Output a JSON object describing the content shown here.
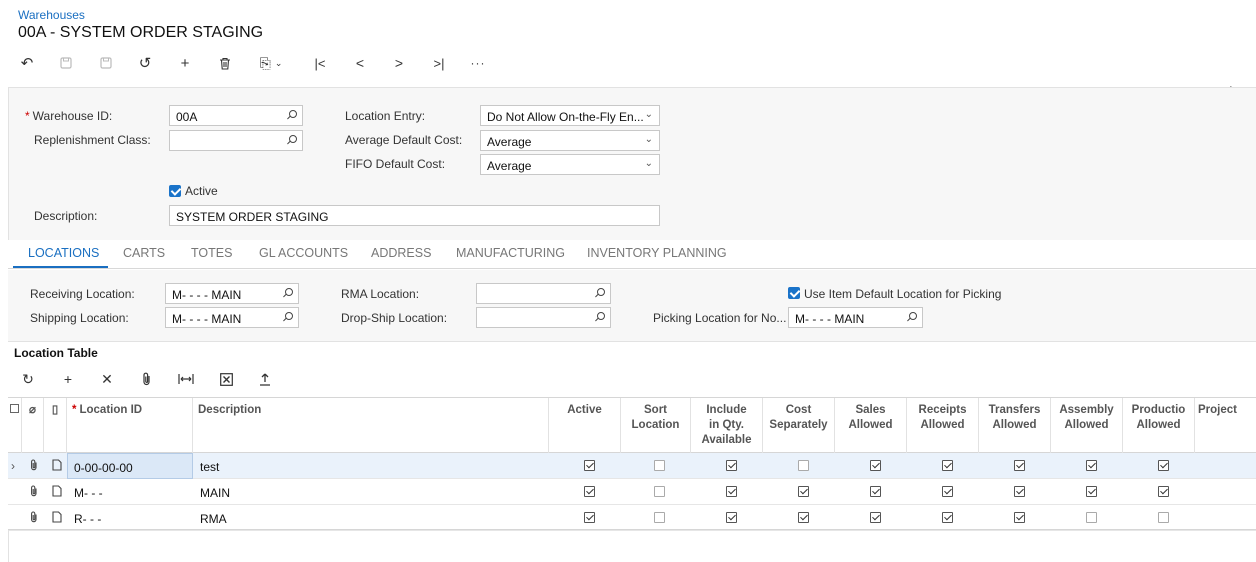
{
  "breadcrumb": "Warehouses",
  "title": "00A - SYSTEM ORDER STAGING",
  "toolbar": [
    {
      "icon": "back-icon",
      "glyph": "↶",
      "disabled": false
    },
    {
      "icon": "save-close-icon",
      "glyph": "▭",
      "disabled": true
    },
    {
      "icon": "save-icon",
      "glyph": "▭",
      "disabled": true
    },
    {
      "icon": "undo-icon",
      "glyph": "↺",
      "disabled": false
    },
    {
      "icon": "add-icon",
      "glyph": "+",
      "disabled": false
    },
    {
      "icon": "delete-icon",
      "glyph": "🗑",
      "disabled": false
    },
    {
      "icon": "copy-paste-icon",
      "glyph": "⎘",
      "disabled": false
    },
    {
      "icon": "first-icon",
      "glyph": "|<",
      "disabled": false
    },
    {
      "icon": "prev-icon",
      "glyph": "<",
      "disabled": false
    },
    {
      "icon": "next-icon",
      "glyph": ">",
      "disabled": false
    },
    {
      "icon": "last-icon",
      "glyph": ">|",
      "disabled": false
    },
    {
      "icon": "more-icon",
      "glyph": "···",
      "disabled": false
    }
  ],
  "form": {
    "warehouse_id_label": "Warehouse ID:",
    "warehouse_id": "00A",
    "replenishment_class_label": "Replenishment Class:",
    "replenishment_class": "",
    "active_label": "Active",
    "active": true,
    "description_label": "Description:",
    "description": "SYSTEM ORDER STAGING",
    "location_entry_label": "Location Entry:",
    "location_entry": "Do Not Allow On-the-Fly En...",
    "avg_default_cost_label": "Average Default Cost:",
    "avg_default_cost": "Average",
    "fifo_default_cost_label": "FIFO Default Cost:",
    "fifo_default_cost": "Average"
  },
  "tabs": [
    "LOCATIONS",
    "CARTS",
    "TOTES",
    "GL ACCOUNTS",
    "ADDRESS",
    "MANUFACTURING",
    "INVENTORY PLANNING"
  ],
  "locations": {
    "receiving_label": "Receiving Location:",
    "receiving": "M-  -  - - MAIN",
    "shipping_label": "Shipping Location:",
    "shipping": "M-  -  - - MAIN",
    "rma_label": "RMA Location:",
    "rma": "",
    "dropship_label": "Drop-Ship Location:",
    "dropship": "",
    "use_default_label": "Use Item Default Location for Picking",
    "use_default": true,
    "picking_label": "Picking Location for No...",
    "picking": "M-  -  - - MAIN"
  },
  "location_table": {
    "title": "Location Table",
    "toolbar_icons": [
      "refresh-icon",
      "add-row-icon",
      "delete-row-icon",
      "attach-icon",
      "fit-columns-icon",
      "export-excel-icon",
      "upload-icon"
    ],
    "columns": [
      "Location ID",
      "Description",
      "Active",
      "Sort Location",
      "Include in Qty. Available",
      "Cost Separately",
      "Sales Allowed",
      "Receipts Allowed",
      "Transfers Allowed",
      "Assembly Allowed",
      "Productio Allowed",
      "Project"
    ],
    "rows": [
      {
        "location_id": "0-00-00-00",
        "description": "test",
        "flags": [
          true,
          false,
          true,
          false,
          true,
          true,
          true,
          true,
          true
        ]
      },
      {
        "location_id": "M- - -",
        "description": "MAIN",
        "flags": [
          true,
          false,
          true,
          true,
          true,
          true,
          true,
          true,
          true
        ]
      },
      {
        "location_id": "R- - -",
        "description": "RMA",
        "flags": [
          true,
          false,
          true,
          true,
          true,
          true,
          true,
          false,
          false
        ]
      }
    ]
  }
}
